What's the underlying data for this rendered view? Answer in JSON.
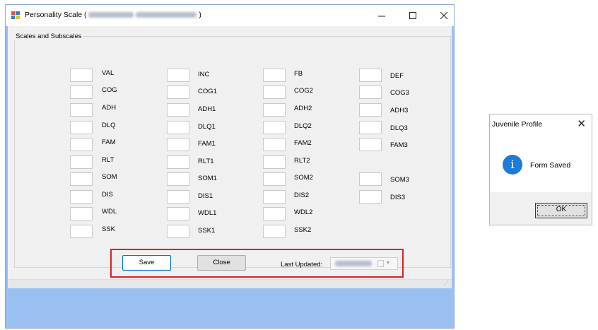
{
  "window": {
    "title_prefix": "Personality Scale (",
    "title_suffix": ")",
    "min_icon": "minimize-icon",
    "max_icon": "maximize-icon",
    "close_icon": "close-icon"
  },
  "group": {
    "label": "Scales and Subscales"
  },
  "scales": {
    "col1": [
      "VAL",
      "COG",
      "ADH",
      "DLQ",
      "FAM",
      "RLT",
      "SOM",
      "DIS",
      "WDL",
      "SSK"
    ],
    "col2": [
      "INC",
      "COG1",
      "ADH1",
      "DLQ1",
      "FAM1",
      "RLT1",
      "SOM1",
      "DIS1",
      "WDL1",
      "SSK1"
    ],
    "col3": [
      "FB",
      "COG2",
      "ADH2",
      "DLQ2",
      "FAM2",
      "RLT2",
      "SOM2",
      "DIS2",
      "WDL2",
      "SSK2"
    ],
    "col4": [
      "DEF",
      "COG3",
      "ADH3",
      "DLQ3",
      "FAM3",
      "",
      "SOM3",
      "DIS3",
      "",
      ""
    ]
  },
  "buttons": {
    "save": "Save",
    "close": "Close"
  },
  "last_updated": {
    "label": "Last Updated:"
  },
  "dialog": {
    "title": "Juvenile Profile",
    "message": "Form Saved",
    "ok": "OK",
    "icon": "info-icon"
  },
  "colors": {
    "window_bg": "#99c0f0",
    "highlight": "#e02020",
    "info": "#1c7cd6"
  }
}
